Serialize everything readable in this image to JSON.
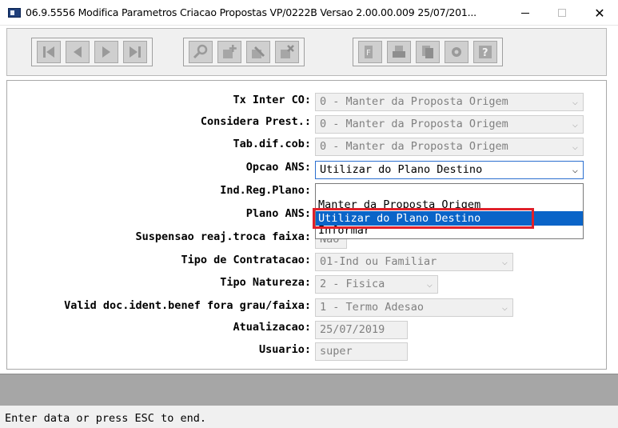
{
  "window": {
    "title": "06.9.5556 Modifica Parametros Criacao Propostas VP/0222B Versao 2.00.00.009 25/07/201...",
    "minimize": "—",
    "close": "✕"
  },
  "toolbar": {
    "nav_icons": [
      "first-icon",
      "previous-icon",
      "next-icon",
      "last-icon"
    ],
    "edit_icons": [
      "search-icon",
      "add-icon",
      "edit-icon",
      "delete-icon"
    ],
    "other_icons": [
      "filter-icon",
      "print-icon",
      "copy-icon",
      "tools-icon",
      "help-icon"
    ]
  },
  "form": {
    "fields": [
      {
        "label": "Tx Inter CO:",
        "value": "0 - Manter da Proposta Origem",
        "has_chevron": true
      },
      {
        "label": "Considera Prest.:",
        "value": "0 - Manter da Proposta Origem",
        "has_chevron": true
      },
      {
        "label": "Tab.dif.cob:",
        "value": "0 - Manter da Proposta Origem",
        "has_chevron": true
      },
      {
        "label": "Opcao ANS:",
        "value": "Utilizar do Plano Destino",
        "has_chevron": true
      },
      {
        "label": "Ind.Reg.Plano:",
        "value": ""
      },
      {
        "label": "Plano ANS:",
        "value": ""
      },
      {
        "label": "Suspensao reaj.troca faixa:",
        "value": "Nao"
      },
      {
        "label": "Tipo de Contratacao:",
        "value": "01-Ind ou Familiar",
        "has_chevron": true
      },
      {
        "label": "Tipo Natureza:",
        "value": "2 - Fisica",
        "has_chevron": true
      },
      {
        "label": "Valid doc.ident.benef fora grau/faixa:",
        "value": "1 - Termo Adesao",
        "has_chevron": true
      },
      {
        "label": "Atualizacao:",
        "value": "25/07/2019"
      },
      {
        "label": "Usuario:",
        "value": "super"
      }
    ],
    "chevron": "⌵"
  },
  "dropdown": {
    "options": [
      "Manter da Proposta Origem",
      "Utilizar do Plano Destino",
      "Informar"
    ],
    "selected_index": 1
  },
  "status": {
    "text": "Enter data or press ESC to end."
  },
  "colors": {
    "selection": "#0a64c8",
    "highlight": "#e0202a",
    "focus_border": "#2b6fcf"
  }
}
